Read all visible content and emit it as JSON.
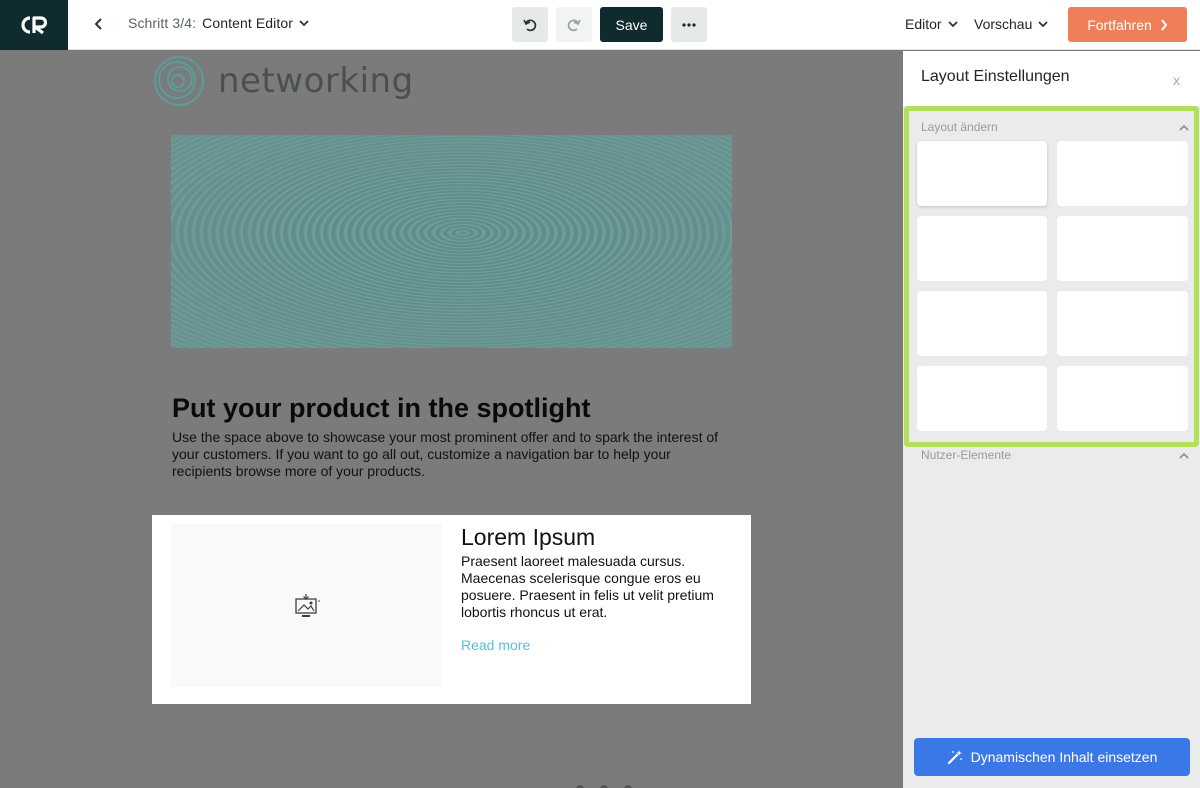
{
  "topbar": {
    "logo_text": "CR",
    "step_label": "Schritt 3/4:",
    "step_title": "Content Editor",
    "save_label": "Save",
    "more_label": "•••",
    "editor_label": "Editor",
    "preview_label": "Vorschau",
    "continue_label": "Fortfahren"
  },
  "email": {
    "brand_name": "networking",
    "headline": "Put your product in the spotlight",
    "body": "Use the space above to showcase your most prominent offer and to spark the interest of your customers. If you want to go all out, customize a navigation bar to help your recipients browse more of your products.",
    "card": {
      "title": "Lorem Ipsum",
      "text": "Praesent laoreet malesuada cursus. Maecenas scelerisque congue eros eu posuere. Praesent in felis ut velit pretium lobortis rhoncus ut erat.",
      "link": "Read more"
    }
  },
  "panel": {
    "title": "Layout Einstellungen",
    "close_label": "x",
    "layout_section_label": "Layout ändern",
    "tiles": [
      "",
      "",
      "",
      "",
      "",
      "",
      "",
      ""
    ],
    "user_section_label": "Nutzer-Elemente",
    "dynamic_button_label": "Dynamischen Inhalt einsetzen"
  },
  "colors": {
    "brand_dark": "#0f2b2e",
    "accent_orange": "#ee7f58",
    "highlight_green": "#b2e05a",
    "primary_blue": "#3b78e7",
    "link_cyan": "#54c3d6"
  }
}
